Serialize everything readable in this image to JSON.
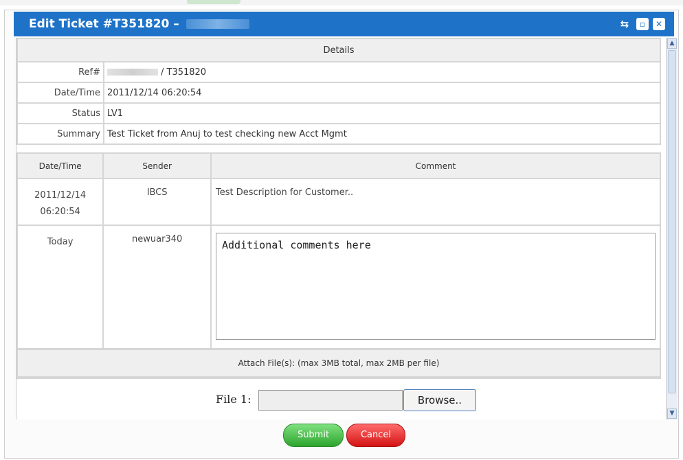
{
  "window": {
    "title": "Edit Ticket #T351820 –",
    "icons": [
      "refresh-icon",
      "maximize-icon",
      "close-icon"
    ]
  },
  "details": {
    "header": "Details",
    "ref_label": "Ref#",
    "ref_value": "/ T351820",
    "datetime_label": "Date/Time",
    "datetime_value": "2011/12/14 06:20:54",
    "status_label": "Status",
    "status_value": "LV1",
    "summary_label": "Summary",
    "summary_value": "Test Ticket from Anuj to test checking new Acct Mgmt"
  },
  "comments": {
    "columns": [
      "Date/Time",
      "Sender",
      "Comment"
    ],
    "rows": [
      {
        "date": "2011/12/14",
        "time": "06:20:54",
        "sender": "IBCS",
        "comment": "Test Description for Customer.."
      },
      {
        "date": "Today",
        "sender": "newuar340",
        "input_value": "Additional comments here"
      }
    ]
  },
  "attach": {
    "header": "Attach File(s): (max 3MB total, max 2MB per file)",
    "file_label": "File 1:",
    "browse_label": "Browse.."
  },
  "buttons": {
    "submit": "Submit",
    "cancel": "Cancel"
  },
  "colors": {
    "titlebar": "#1e73c8",
    "status": "#2a9a2a",
    "submit": "#2da52d",
    "cancel": "#d41414"
  }
}
